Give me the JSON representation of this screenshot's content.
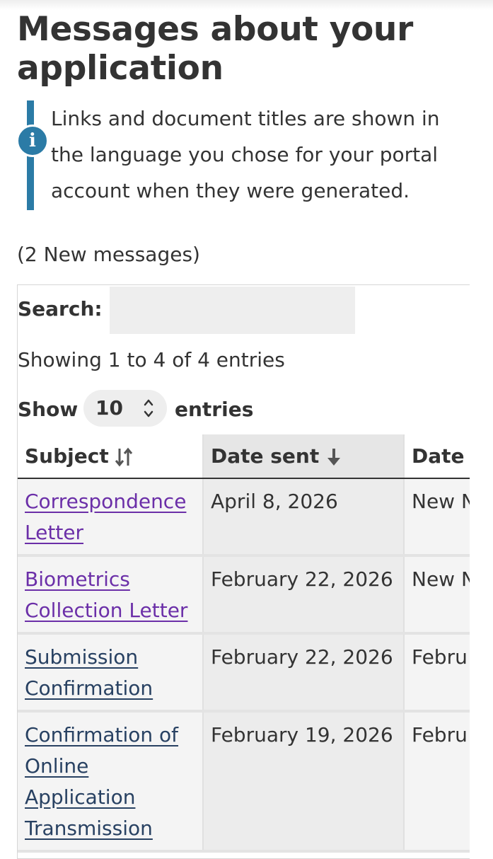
{
  "page": {
    "title": "Messages about your application"
  },
  "notice": {
    "icon": "info-icon",
    "icon_glyph": "i",
    "text": "Links and document titles are shown in the language you chose for your portal account when they were generated."
  },
  "messages_count": "(2 New messages)",
  "table_controls": {
    "search_label": "Search:",
    "search_value": "",
    "info": "Showing 1 to 4 of 4 entries",
    "length_prefix": "Show",
    "length_value": "10",
    "length_suffix": "entries"
  },
  "table": {
    "columns": [
      {
        "label": "Subject",
        "sort": "sortable",
        "icon": "sort-both-icon"
      },
      {
        "label": "Date sent",
        "sort": "descending",
        "icon": "sort-down-icon"
      },
      {
        "label": "Date",
        "sort": "none"
      }
    ],
    "rows": [
      {
        "subject": "Correspondence Letter",
        "date_sent": "April 8, 2026",
        "date": "New N",
        "unread": true
      },
      {
        "subject": "Biometrics Collection Letter",
        "date_sent": "February 22, 2026",
        "date": "New N",
        "unread": true
      },
      {
        "subject": "Submission Confirmation",
        "date_sent": "February 22, 2026",
        "date": "Febru",
        "unread": false
      },
      {
        "subject": "Confirmation of Online Application Transmission",
        "date_sent": "February 19, 2026",
        "date": "Febru",
        "unread": false
      }
    ]
  },
  "colors": {
    "notice_accent": "#2b7ba6",
    "unread_link": "#6b2fa8",
    "read_link": "#284162",
    "text": "#333333"
  }
}
